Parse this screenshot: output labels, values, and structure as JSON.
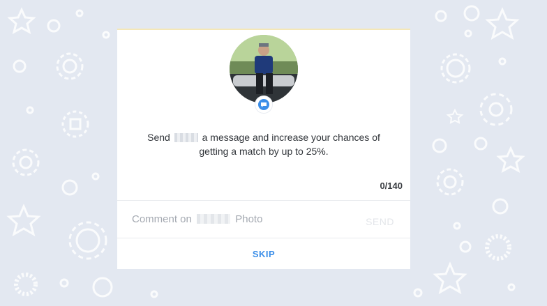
{
  "card": {
    "message_before": "Send",
    "message_after": "a message and increase your chances of getting a match by up to 25%.",
    "char_counter": "0/140",
    "comment_prefix": "Comment on",
    "comment_suffix": "Photo",
    "send_label": "SEND",
    "skip_label": "SKIP"
  },
  "icons": {
    "badge": "chat-bubble-icon",
    "background": [
      "star-icon",
      "gear-icon",
      "circle-icon",
      "sun-icon"
    ]
  },
  "colors": {
    "background": "#e3e8f1",
    "accent": "#3b8ee8",
    "deco": "#ffffff"
  }
}
